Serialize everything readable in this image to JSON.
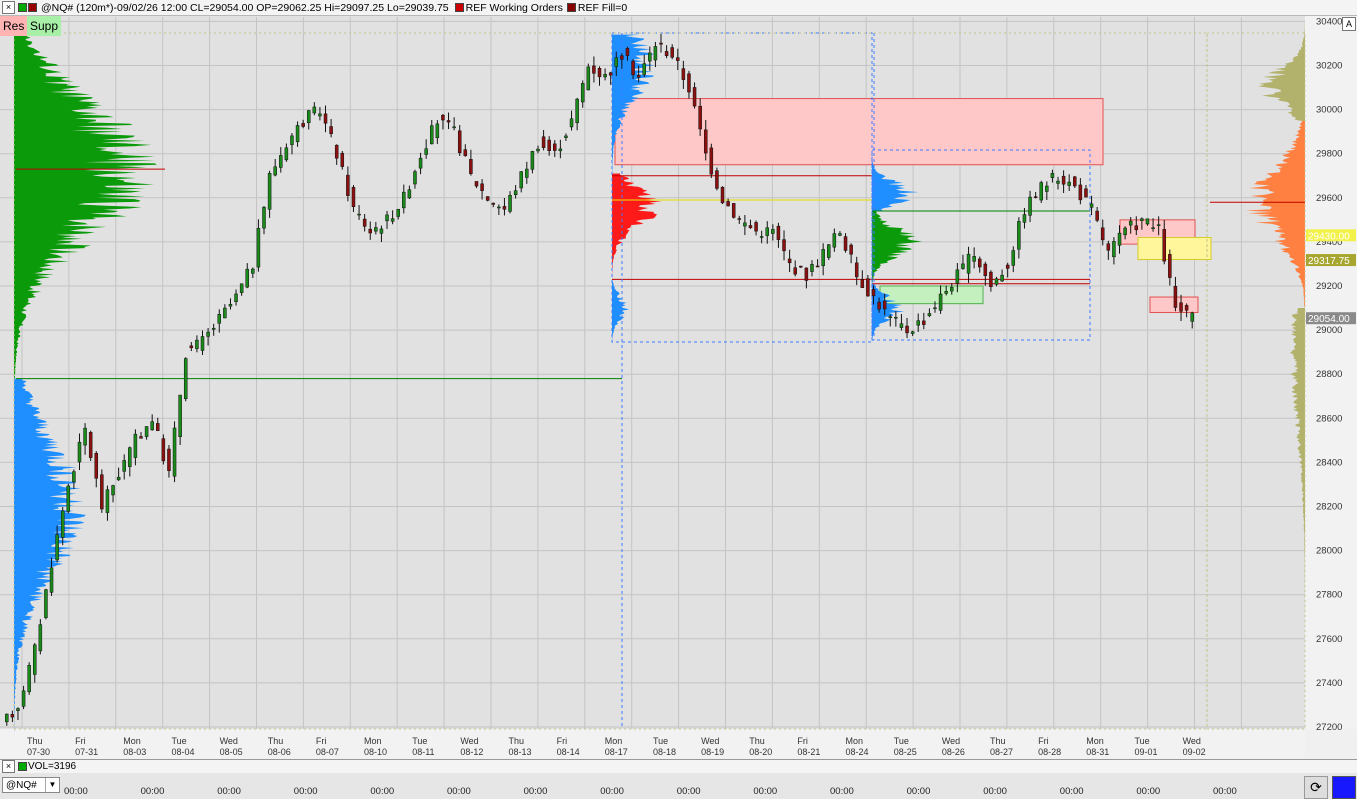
{
  "window": {
    "close_glyph": "×",
    "title": "@NQ# (120m*)-09/02/26 12:00 CL=29054.00 OP=29062.25 Hi=29097.25 Lo=29039.75",
    "ref_working_orders": "REF Working Orders",
    "ref_fill": "REF Fill=0"
  },
  "toggles": {
    "res": "Res",
    "supp": "Supp",
    "auto_scale": "A"
  },
  "colors": {
    "up": "#1a8a1a",
    "down": "#8b1010",
    "green_profile": "#0a9a0a",
    "blue_profile": "#1f8fff",
    "red_profile": "#ff1a1a",
    "orange_profile": "#ff8040",
    "olive_profile": "#b2b26c",
    "plot_bg": "#e1e1e1"
  },
  "price_axis": {
    "labels": [
      "30400",
      "30200",
      "30000",
      "29800",
      "29600",
      "29400",
      "29200",
      "29000",
      "28800",
      "28600",
      "28400",
      "28200",
      "28000",
      "27800",
      "27600",
      "27400",
      "27200"
    ],
    "markers": [
      {
        "value": "29430.00",
        "color": "#f2f24a"
      },
      {
        "value": "29317.75",
        "color": "#a6a630"
      },
      {
        "value": "29054.00",
        "color": "#8a8a8a"
      }
    ]
  },
  "date_axis": [
    {
      "day": "Thu",
      "date": "07-30"
    },
    {
      "day": "Fri",
      "date": "07-31"
    },
    {
      "day": "Mon",
      "date": "08-03"
    },
    {
      "day": "Tue",
      "date": "08-04"
    },
    {
      "day": "Wed",
      "date": "08-05"
    },
    {
      "day": "Thu",
      "date": "08-06"
    },
    {
      "day": "Fri",
      "date": "08-07"
    },
    {
      "day": "Mon",
      "date": "08-10"
    },
    {
      "day": "Tue",
      "date": "08-11"
    },
    {
      "day": "Wed",
      "date": "08-12"
    },
    {
      "day": "Thu",
      "date": "08-13"
    },
    {
      "day": "Fri",
      "date": "08-14"
    },
    {
      "day": "Mon",
      "date": "08-17"
    },
    {
      "day": "Tue",
      "date": "08-18"
    },
    {
      "day": "Wed",
      "date": "08-19"
    },
    {
      "day": "Thu",
      "date": "08-20"
    },
    {
      "day": "Fri",
      "date": "08-21"
    },
    {
      "day": "Mon",
      "date": "08-24"
    },
    {
      "day": "Tue",
      "date": "08-25"
    },
    {
      "day": "Wed",
      "date": "08-26"
    },
    {
      "day": "Thu",
      "date": "08-27"
    },
    {
      "day": "Fri",
      "date": "08-28"
    },
    {
      "day": "Mon",
      "date": "08-31"
    },
    {
      "day": "Tue",
      "date": "09-01"
    },
    {
      "day": "Wed",
      "date": "09-02"
    }
  ],
  "chart_data": {
    "type": "candlestick",
    "interval": "120m",
    "ylim": [
      27150,
      30420
    ],
    "series": [
      {
        "name": "@NQ#",
        "closes": [
          27300,
          27550,
          27950,
          28300,
          28550,
          28200,
          28350,
          28500,
          28600,
          28350,
          28900,
          28950,
          29050,
          29150,
          29300,
          29700,
          29850,
          29950,
          30000,
          29800,
          29550,
          29450,
          29500,
          29600,
          29800,
          29950,
          29900,
          29700,
          29600,
          29550,
          29700,
          29850,
          29800,
          29950,
          30200,
          30150,
          30250,
          30150,
          30300,
          30250,
          30100,
          29800,
          29600,
          29500,
          29450,
          29450,
          29300,
          29250,
          29350,
          29450,
          29250,
          29150,
          29050,
          29000,
          29050,
          29150,
          29250,
          29350,
          29200,
          29300,
          29550,
          29650,
          29700,
          29650,
          29550,
          29350,
          29450,
          29500,
          29450,
          29100,
          29050
        ]
      }
    ],
    "zones": [
      {
        "kind": "resistance",
        "low": 29750,
        "high": 30050
      },
      {
        "kind": "resistance",
        "low": 29390,
        "high": 29500
      },
      {
        "kind": "resistance",
        "low": 29080,
        "high": 29150
      },
      {
        "kind": "current",
        "low": 29320,
        "high": 29420
      },
      {
        "kind": "support",
        "low": 29120,
        "high": 29200
      }
    ],
    "levels": [
      {
        "value": 29730,
        "color": "#c00000"
      },
      {
        "value": 28780,
        "color": "#008000"
      },
      {
        "value": 29700,
        "color": "#c00000"
      },
      {
        "value": 29230,
        "color": "#c00000"
      },
      {
        "value": 29590,
        "color": "#e8e000"
      },
      {
        "value": 29540,
        "color": "#008000"
      },
      {
        "value": 29210,
        "color": "#c00000"
      },
      {
        "value": 29580,
        "color": "#c00000"
      }
    ]
  },
  "volume_panel": {
    "label": "VOL=3196"
  },
  "time_axis": {
    "symbol": "@NQ#",
    "tick_label": "00:00",
    "tick_count": 16
  },
  "controls": {
    "refresh_glyph": "⟳"
  }
}
